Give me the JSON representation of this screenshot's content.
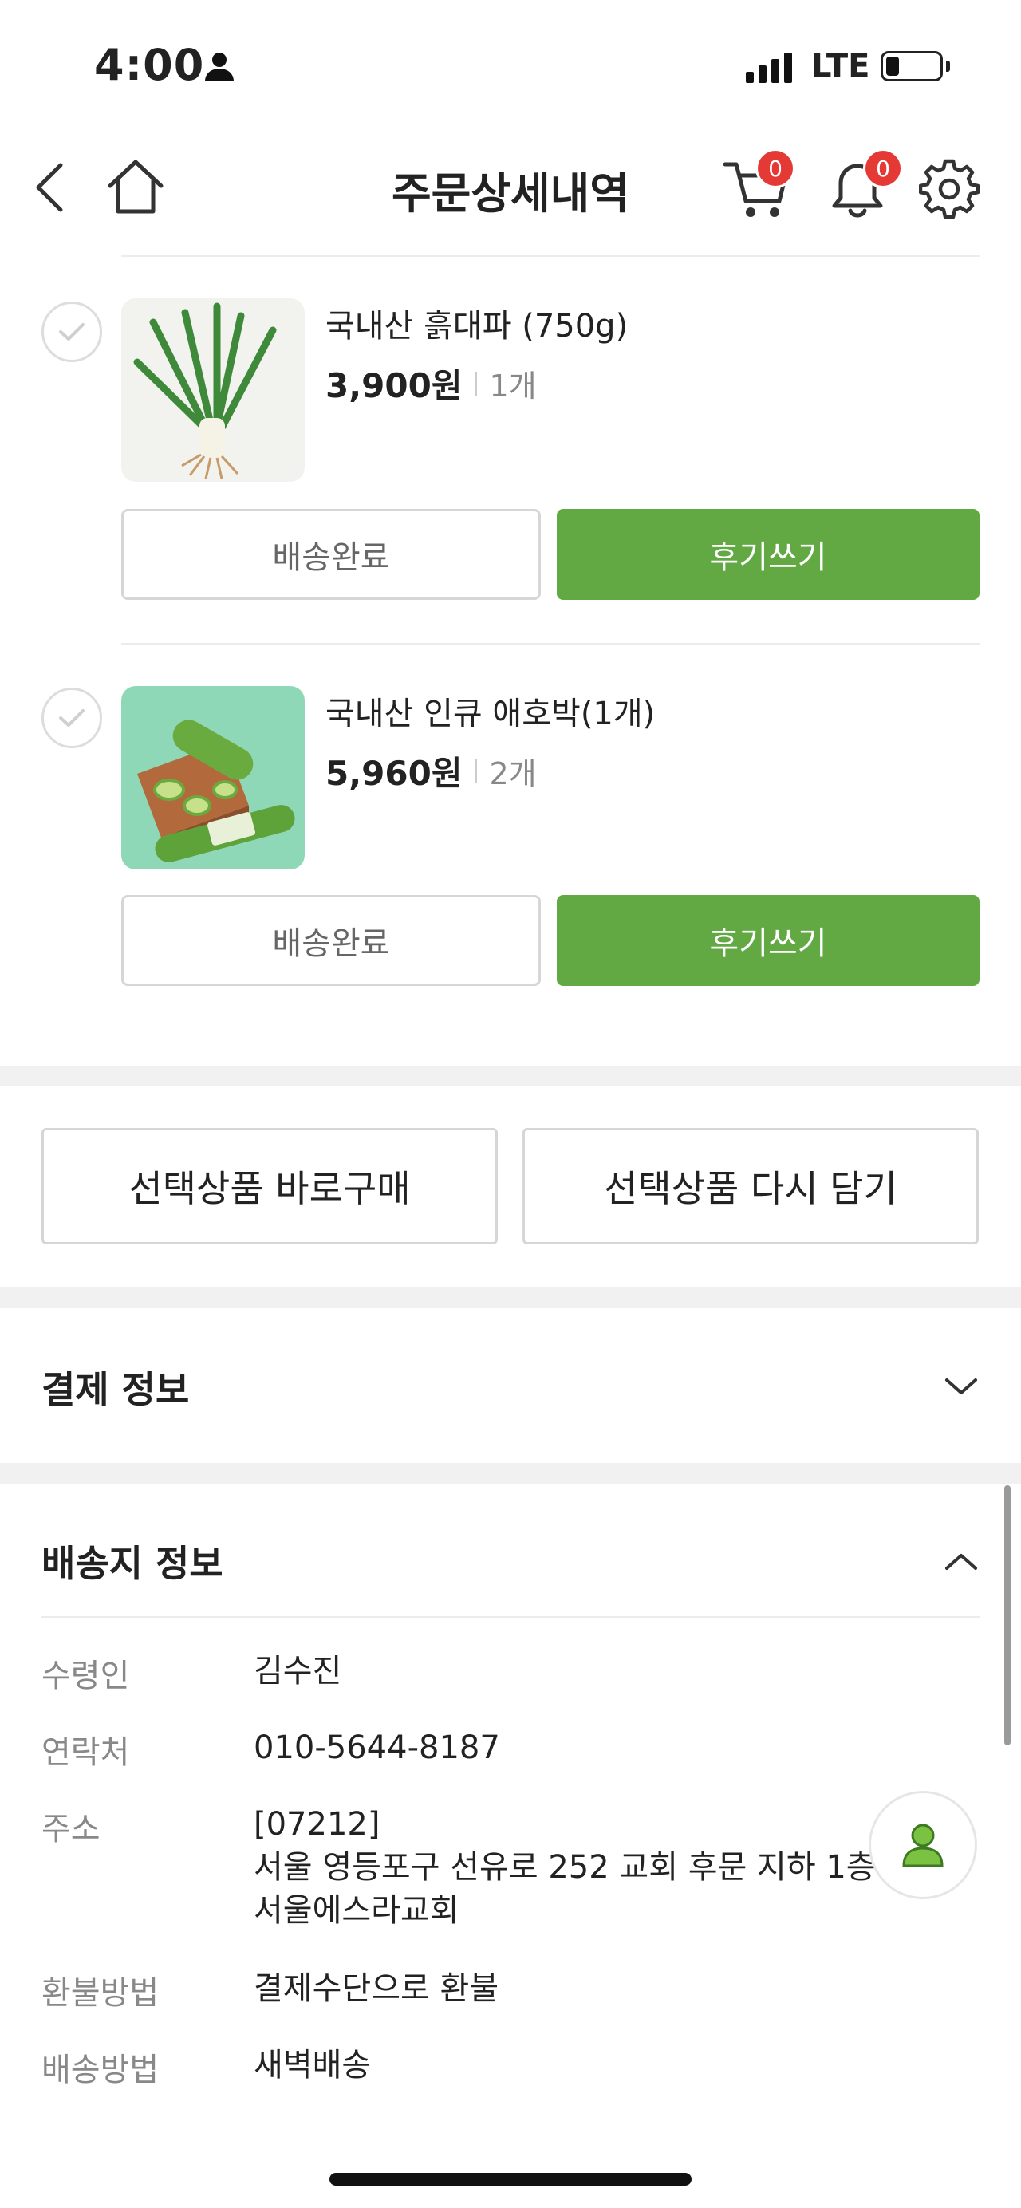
{
  "status_bar": {
    "time": "4:00",
    "network": "LTE",
    "battery_level": 0.25
  },
  "header": {
    "title": "주문상세내역",
    "cart_count": "0",
    "notification_count": "0"
  },
  "colors": {
    "accent_green": "#62a843",
    "badge_red": "#e53935"
  },
  "products": [
    {
      "name": "국내산 흙대파 (750g)",
      "price": "3,900원",
      "quantity": "1개",
      "status_label": "배송완료",
      "review_label": "후기쓰기"
    },
    {
      "name": "국내산 인큐 애호박(1개)",
      "price": "5,960원",
      "quantity": "2개",
      "status_label": "배송완료",
      "review_label": "후기쓰기"
    }
  ],
  "actions": {
    "buy_now": "선택상품 바로구매",
    "add_to_cart_again": "선택상품 다시 담기"
  },
  "payment_section": {
    "title": "결제 정보"
  },
  "delivery_section": {
    "title": "배송지 정보",
    "rows": [
      {
        "label": "수령인",
        "value": "김수진"
      },
      {
        "label": "연락처",
        "value": "010-5644-8187"
      },
      {
        "label": "주소",
        "zip": "[07212]",
        "line1": "서울 영등포구 선유로 252 교회 후문 지하 1층",
        "line2": "서울에스라교회"
      },
      {
        "label": "환불방법",
        "value": "결제수단으로 환불"
      },
      {
        "label": "배송방법",
        "value": "새벽배송"
      }
    ]
  }
}
